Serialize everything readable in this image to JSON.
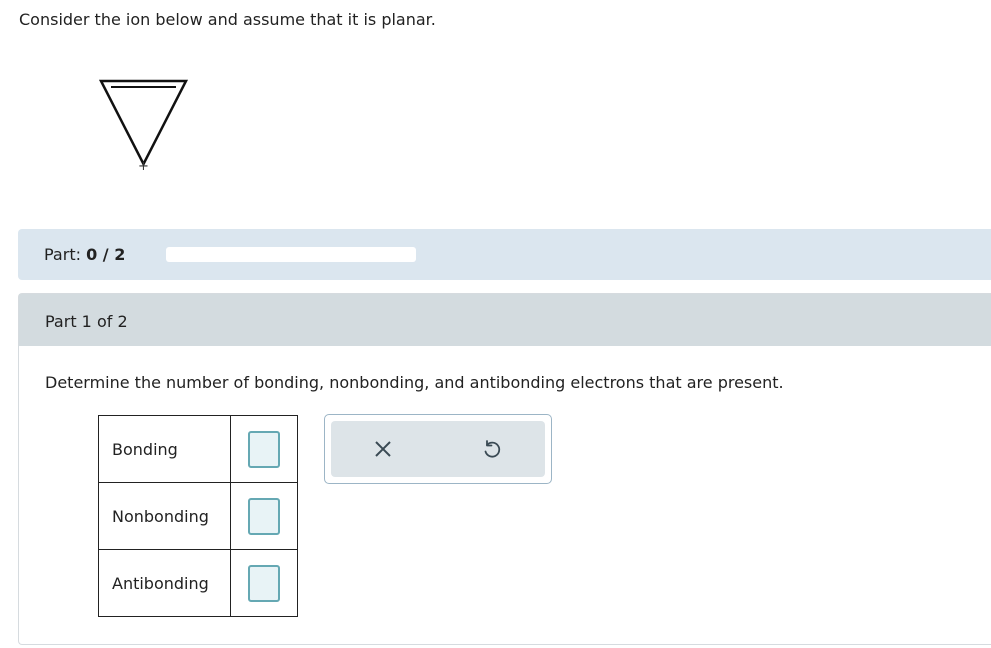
{
  "question": {
    "text": "Consider the ion below and assume that it is planar."
  },
  "molecule": {
    "charge": "+"
  },
  "part_bar": {
    "label": "Part:",
    "score": "0 / 2",
    "progress_fraction": 0
  },
  "section": {
    "title": "Part 1 of 2",
    "prompt": "Determine the number of bonding, nonbonding, and antibonding electrons that are present."
  },
  "table": {
    "rows": [
      {
        "label": "Bonding",
        "value": ""
      },
      {
        "label": "Nonbonding",
        "value": ""
      },
      {
        "label": "Antibonding",
        "value": ""
      }
    ]
  },
  "tools": {
    "clear_icon": "close-icon",
    "undo_icon": "undo-icon"
  },
  "colors": {
    "part_bar_bg": "#dbe6ef",
    "section_header_bg": "#d3dbdf",
    "input_border": "#65a8b3",
    "input_fill": "#e8f3f6"
  }
}
